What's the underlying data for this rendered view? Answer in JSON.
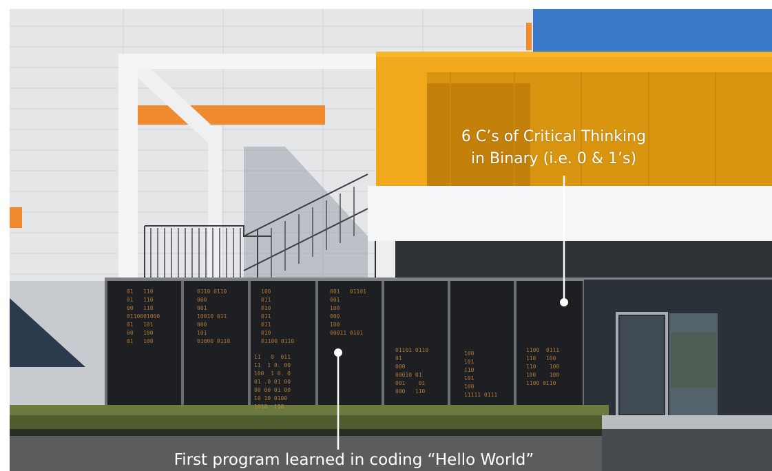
{
  "annotations": {
    "top_caption": "6 C’s of Critical Thinking\nin Binary (i.e. 0 & 1’s)",
    "bottom_caption": "First program learned in coding “Hello World”"
  },
  "scene": {
    "wall_color": "#e4e6e8",
    "accent_orange": "#f08a2e",
    "canopy_yellow": "#f2a81d",
    "sky_blue": "#3a78c8",
    "screen_black": "#1d1f22",
    "grass_green": "#6b7a3e",
    "binary_color": "#c8873a"
  },
  "binary_blocks": [
    "01   110\n01   110\n00   110\n0110001000\n01   101\n00   100\n01   100",
    "0110 0110\n000\n001\n10010 011\n000\n101\n01000 0110",
    "100\n011\n010\n011\n011\n010\n01100 0110",
    "11   0  011\n11  1 0. 00\n100  1 0. 0\n01 .0 01 00\n00 00 01 00\n10 10 0100\n1010  110",
    "001   01101\n001\n100\n000\n100\n00011 0101",
    "01101 0110\n01\n000\n00010 01\n001    01\n000   110",
    "1100  0111\n110   100\n110    100\n100    100\n1100 0110",
    "100\n101\n110\n101\n100\n11111 0111"
  ]
}
